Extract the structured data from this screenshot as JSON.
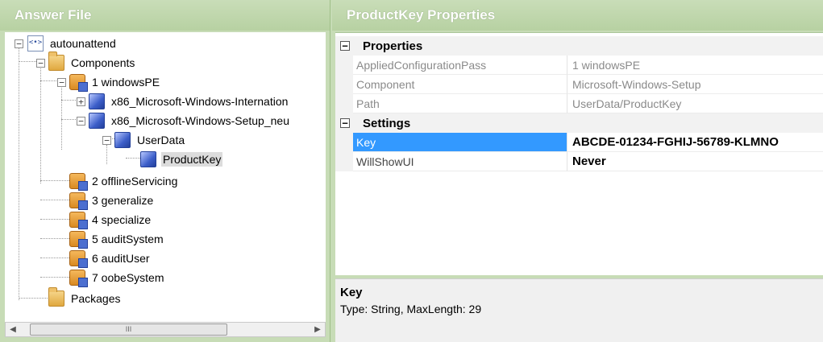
{
  "left_pane": {
    "title": "Answer File",
    "tree": {
      "root": "autounattend",
      "components": "Components",
      "pass1": "1 windowsPE",
      "comp_international": "x86_Microsoft-Windows-Internation",
      "comp_setup": "x86_Microsoft-Windows-Setup_neu",
      "userdata": "UserData",
      "productkey": "ProductKey",
      "pass2": "2 offlineServicing",
      "pass3": "3 generalize",
      "pass4": "4 specialize",
      "pass5": "5 auditSystem",
      "pass6": "6 auditUser",
      "pass7": "7 oobeSystem",
      "packages": "Packages"
    },
    "scrollbar": {
      "thumb_grip": "III",
      "left_arrow": "◀",
      "right_arrow": "▶"
    }
  },
  "right_pane": {
    "title": "ProductKey Properties",
    "categories": [
      {
        "label": "Properties",
        "toggle": "−",
        "rows": [
          {
            "name": "AppliedConfigurationPass",
            "value": "1 windowsPE"
          },
          {
            "name": "Component",
            "value": "Microsoft-Windows-Setup"
          },
          {
            "name": "Path",
            "value": "UserData/ProductKey"
          }
        ]
      },
      {
        "label": "Settings",
        "toggle": "−",
        "rows": [
          {
            "name": "Key",
            "value": "ABCDE-01234-FGHIJ-56789-KLMNO"
          },
          {
            "name": "WillShowUI",
            "value": "Never"
          }
        ]
      }
    ],
    "description": {
      "title": "Key",
      "text": "Type: String, MaxLength: 29"
    }
  },
  "icons": {
    "xml": "xml-icon",
    "folder": "folder-icon",
    "pass": "pass-icon",
    "component": "cube-icon"
  },
  "colors": {
    "header_bg": "#b7d1a2",
    "selection": "#3399ff"
  }
}
